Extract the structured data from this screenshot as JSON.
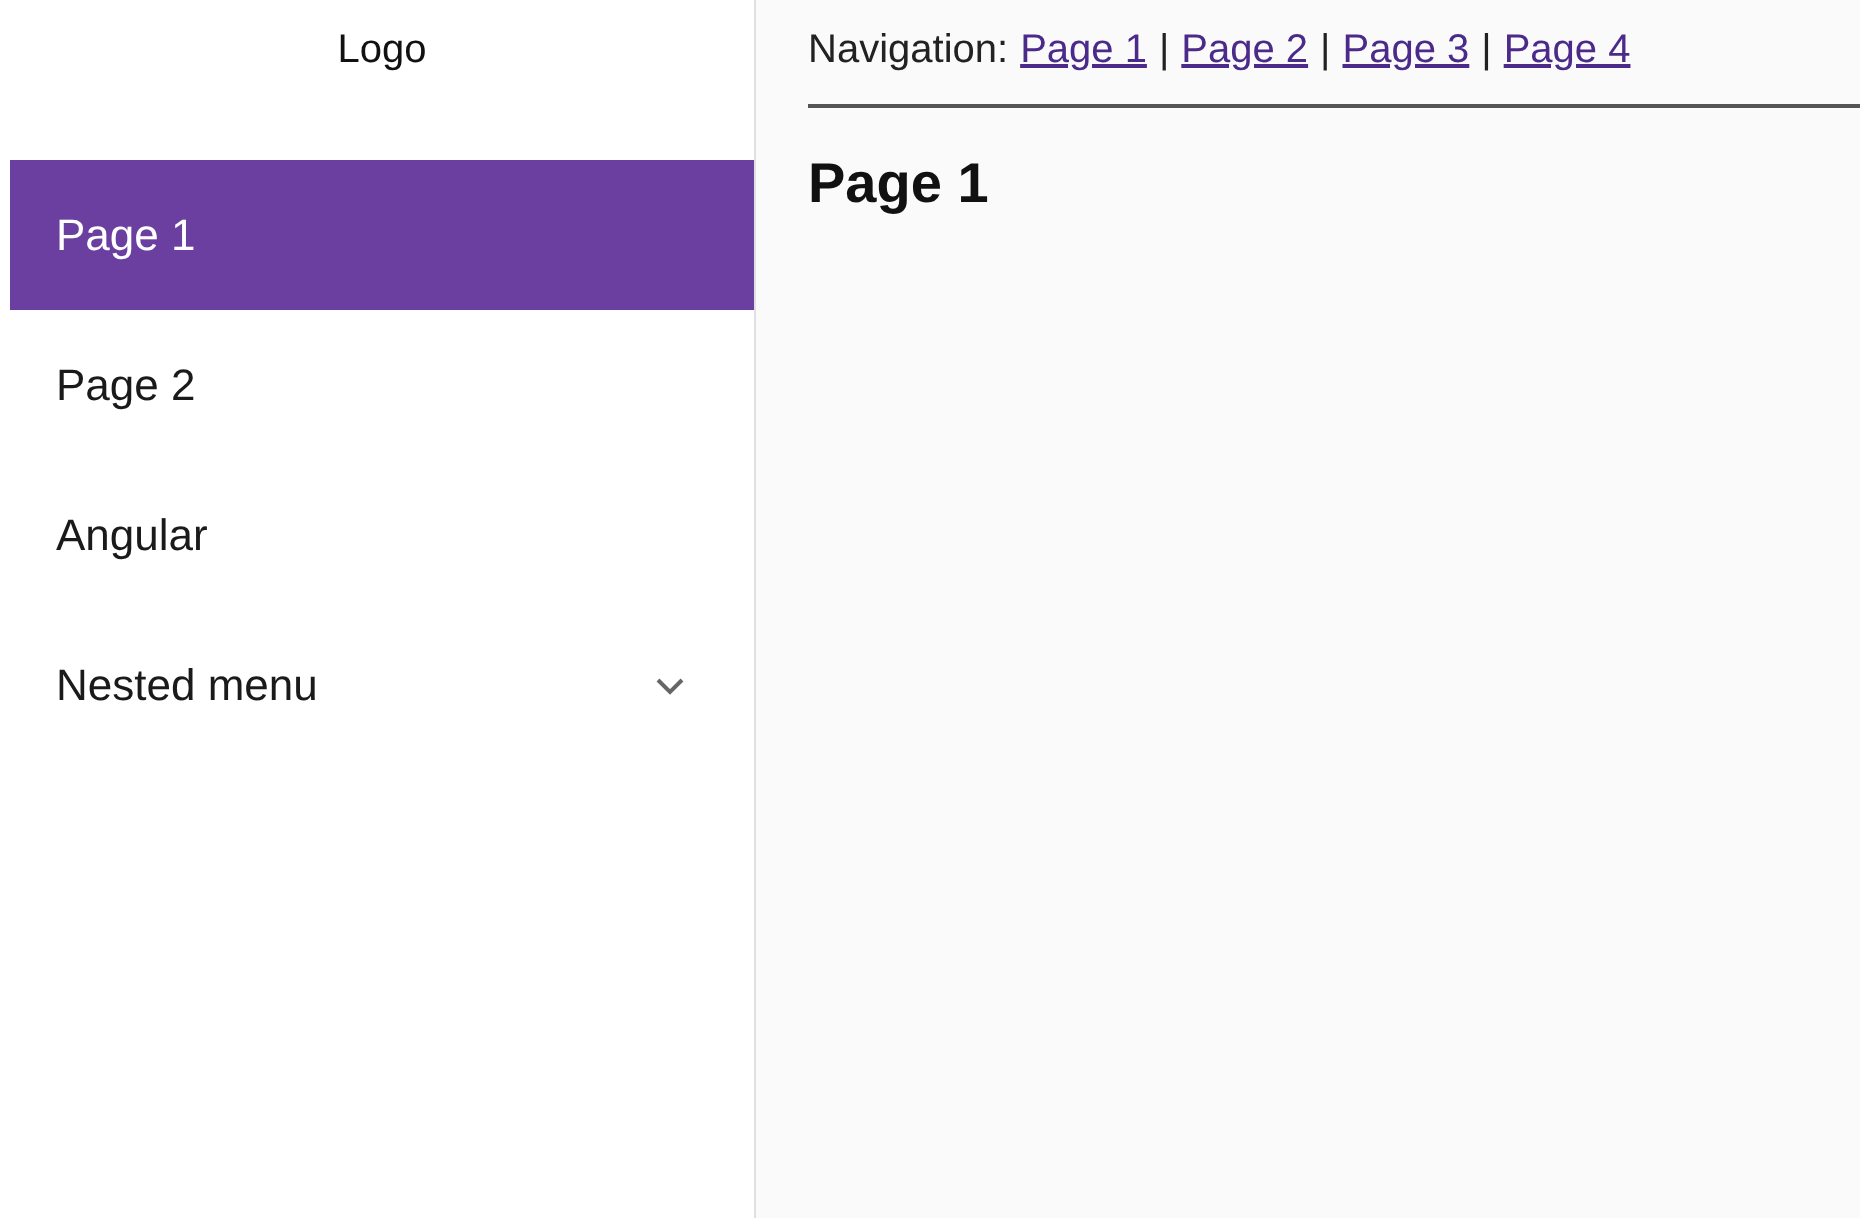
{
  "sidebar": {
    "logo": "Logo",
    "items": [
      {
        "label": "Page 1",
        "selected": true,
        "kind": "link"
      },
      {
        "label": "Page 2",
        "selected": false,
        "kind": "link"
      },
      {
        "label": "Angular",
        "selected": false,
        "kind": "link"
      },
      {
        "label": "Nested menu",
        "selected": false,
        "kind": "group",
        "expanded": false
      }
    ]
  },
  "navigation": {
    "label": "Navigation:",
    "separator": "|",
    "links": [
      "Page 1",
      "Page 2",
      "Page 3",
      "Page 4"
    ]
  },
  "content": {
    "heading": "Page 1"
  }
}
